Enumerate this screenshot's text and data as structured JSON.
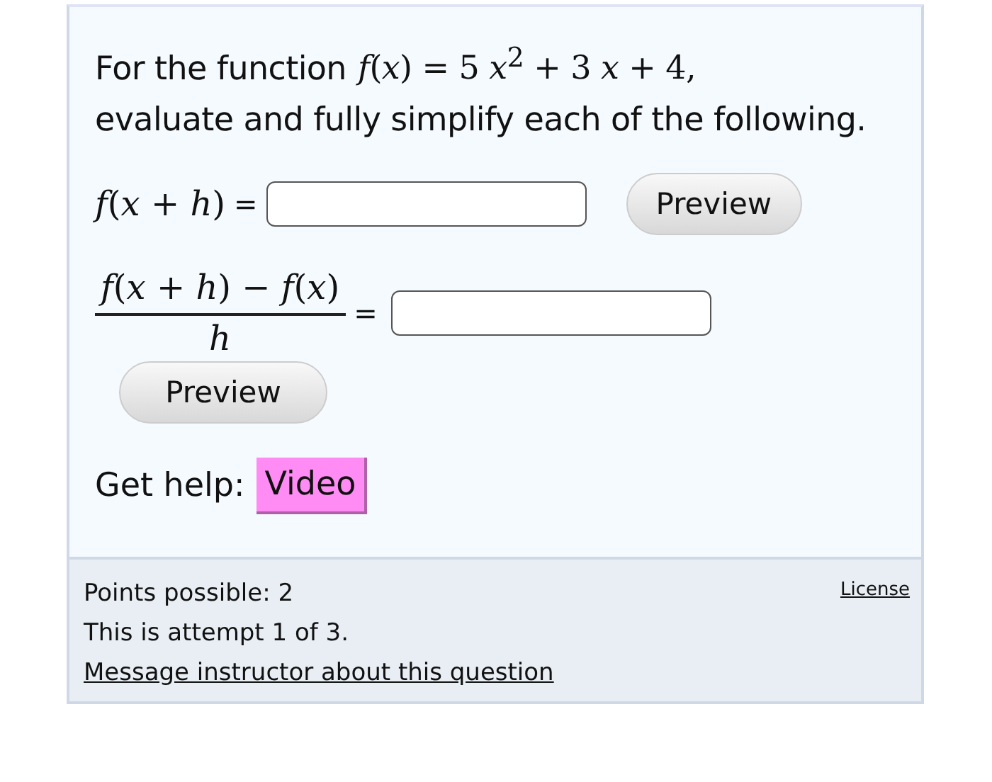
{
  "question": {
    "prompt": "For the function",
    "formula": "*f*(*x*) = 5 *x*$^{2}$ + 3 *x* + 4,",
    "instruction": "evaluate and fully simplify each of the following."
  },
  "parts": [
    {
      "kind": "inline",
      "label": "*f*(*x* + *h*)",
      "equals": "=",
      "preview_button": "Preview"
    },
    {
      "kind": "fraction",
      "numerator": "*f*(*x* + *h*) − *f*(*x*)",
      "denominator": "*h*",
      "equals": "=",
      "preview_button": "Preview"
    }
  ],
  "help": {
    "label": "Get help:",
    "button": "Video"
  },
  "footer": {
    "points": "Points possible: 2",
    "attempt": "This is attempt 1 of 3.",
    "message_link": "Message instructor about this question",
    "license_link": "License"
  }
}
